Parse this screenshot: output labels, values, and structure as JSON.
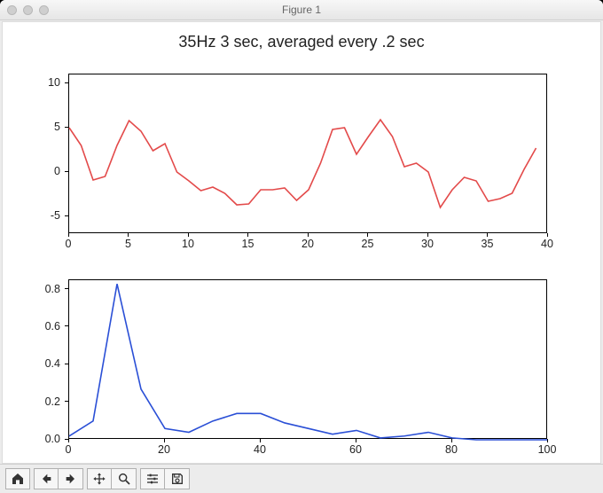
{
  "window": {
    "title": "Figure 1"
  },
  "figure": {
    "title": "35Hz 3 sec, averaged every .2 sec"
  },
  "toolbar": {
    "home": "Home",
    "back": "Back",
    "forward": "Forward",
    "pan": "Pan",
    "zoom": "Zoom",
    "subplots": "Configure subplots",
    "save": "Save"
  },
  "chart_data": [
    {
      "type": "line",
      "title": "",
      "xlabel": "",
      "ylabel": "",
      "xlim": [
        0,
        40
      ],
      "ylim": [
        -7,
        11
      ],
      "xticks": [
        0,
        5,
        10,
        15,
        20,
        25,
        30,
        35,
        40
      ],
      "yticks": [
        -5,
        0,
        5,
        10
      ],
      "color": "#e34a4a",
      "x": [
        0,
        1,
        2,
        3,
        4,
        5,
        6,
        7,
        8,
        9,
        10,
        11,
        12,
        13,
        14,
        15,
        16,
        17,
        18,
        19,
        20,
        21,
        22,
        23,
        24,
        25,
        26,
        27,
        28,
        29,
        30,
        31,
        32,
        33,
        34,
        35,
        36,
        37,
        38,
        39
      ],
      "y": [
        5.0,
        3.0,
        -0.9,
        -0.5,
        3.0,
        5.8,
        4.6,
        2.4,
        3.2,
        0.0,
        -1.0,
        -2.1,
        -1.7,
        -2.4,
        -3.7,
        -3.6,
        -2.0,
        -2.0,
        -1.8,
        -3.2,
        -2.0,
        1.0,
        4.8,
        5.0,
        2.0,
        4.0,
        5.9,
        4.0,
        0.6,
        1.0,
        0.0,
        -4.0,
        -2.0,
        -0.6,
        -1.0,
        -3.3,
        -3.0,
        -2.4,
        0.3,
        2.7
      ]
    },
    {
      "type": "line",
      "title": "",
      "xlabel": "",
      "ylabel": "",
      "xlim": [
        0,
        100
      ],
      "ylim": [
        0.0,
        0.85
      ],
      "xticks": [
        0,
        20,
        40,
        60,
        80,
        100
      ],
      "yticks": [
        0.0,
        0.2,
        0.4,
        0.6,
        0.8
      ],
      "color": "#2a4fd6",
      "x": [
        0,
        5,
        10,
        15,
        20,
        25,
        30,
        35,
        40,
        45,
        50,
        55,
        60,
        65,
        70,
        75,
        80,
        85,
        90,
        95,
        100
      ],
      "y": [
        0.02,
        0.1,
        0.83,
        0.27,
        0.06,
        0.04,
        0.1,
        0.14,
        0.14,
        0.09,
        0.06,
        0.03,
        0.05,
        0.01,
        0.02,
        0.04,
        0.01,
        0.0,
        0.0,
        0.0,
        0.0
      ]
    }
  ]
}
